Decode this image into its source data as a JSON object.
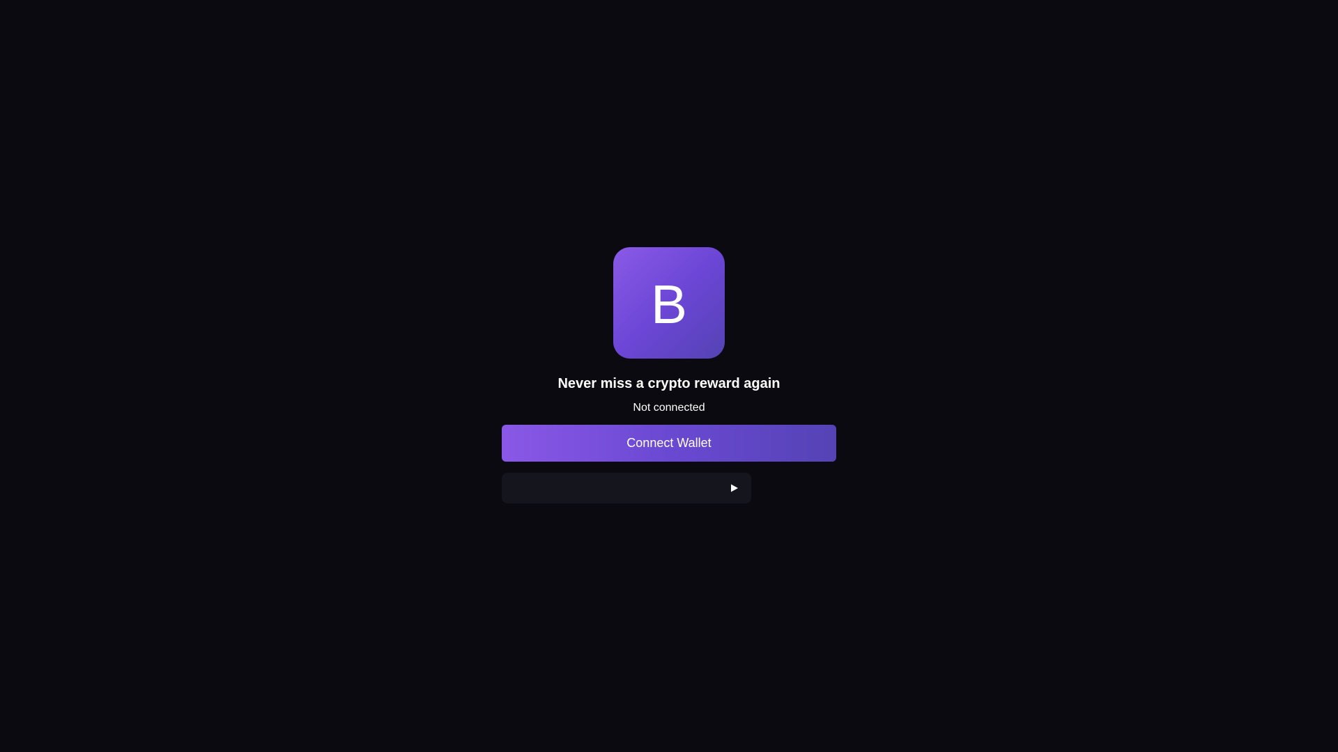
{
  "logo": {
    "letter": "B",
    "gradient_start": "#8a5ae6",
    "gradient_end": "#5443b4"
  },
  "headline": "Never miss a crypto reward again",
  "status": "Not connected",
  "connect_button": {
    "label": "Connect Wallet"
  },
  "media_player": {
    "play_icon": "play-icon"
  },
  "colors": {
    "background": "#0b0a10",
    "accent": "#7b50dc",
    "panel": "#15151d",
    "text": "#ffffff"
  }
}
